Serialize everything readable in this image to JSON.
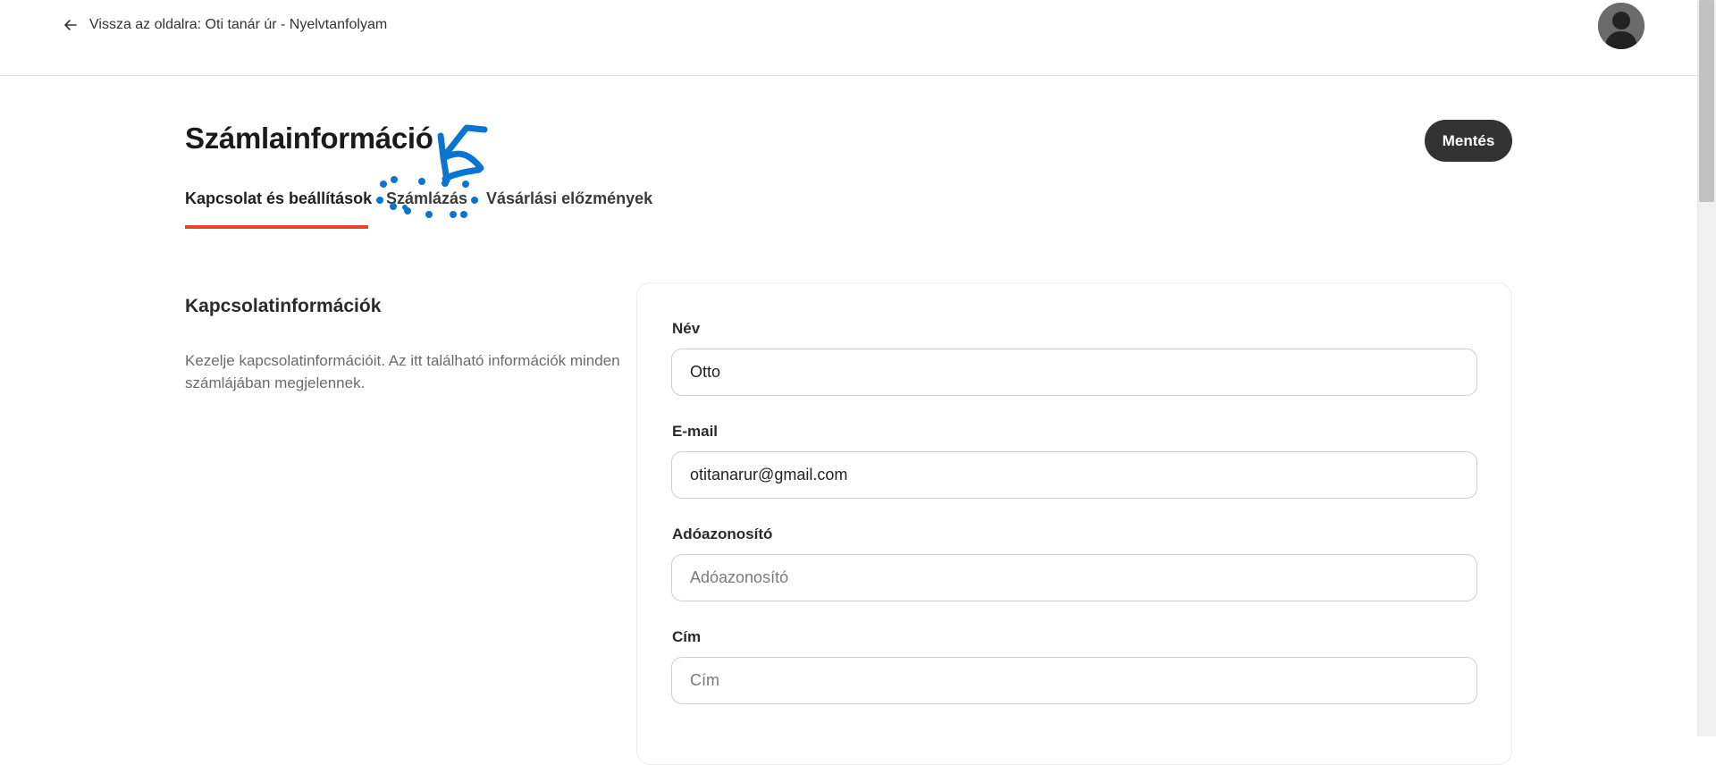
{
  "header": {
    "back_label": "Vissza az oldalra: Oti tanár úr - Nyelvtanfolyam"
  },
  "page": {
    "title": "Számlainformáció",
    "save_label": "Mentés"
  },
  "tabs": [
    {
      "label": "Kapcsolat és beállítások",
      "active": true
    },
    {
      "label": "Számlázás",
      "active": false
    },
    {
      "label": "Vásárlási előzmények",
      "active": false
    }
  ],
  "contact_section": {
    "title": "Kapcsolatinformációk",
    "description": "Kezelje kapcsolatinformációit. Az itt található információk minden számlájában megjelennek."
  },
  "form": {
    "name": {
      "label": "Név",
      "value": "Otto",
      "placeholder": ""
    },
    "email": {
      "label": "E-mail",
      "value": "otitanarur@gmail.com",
      "placeholder": ""
    },
    "tax_id": {
      "label": "Adóazonosító",
      "value": "",
      "placeholder": "Adóazonosító"
    },
    "address": {
      "label": "Cím",
      "value": "",
      "placeholder": "Cím"
    }
  },
  "colors": {
    "accent_underline": "#e8432d",
    "annotation": "#0a74d0",
    "button_bg": "#333333"
  }
}
